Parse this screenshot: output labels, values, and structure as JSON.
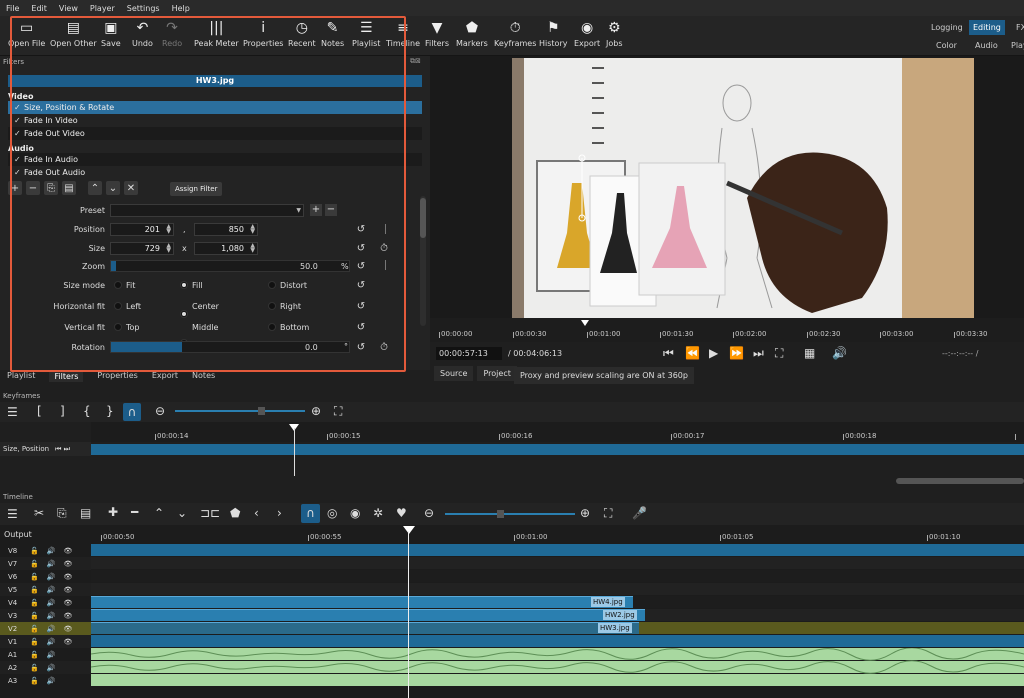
{
  "menu": [
    "File",
    "Edit",
    "View",
    "Player",
    "Settings",
    "Help"
  ],
  "toolbar": [
    {
      "label": "Open File",
      "icon": "open-file-icon"
    },
    {
      "label": "Open Other",
      "icon": "open-other-icon"
    },
    {
      "label": "Save",
      "icon": "save-icon"
    },
    {
      "label": "Undo",
      "icon": "undo-icon"
    },
    {
      "label": "Redo",
      "icon": "redo-icon"
    },
    {
      "label": "Peak Meter",
      "icon": "peak-meter-icon"
    },
    {
      "label": "Properties",
      "icon": "info-icon"
    },
    {
      "label": "Recent",
      "icon": "clock-icon"
    },
    {
      "label": "Notes",
      "icon": "notes-icon"
    },
    {
      "label": "Playlist",
      "icon": "list-icon"
    },
    {
      "label": "Timeline",
      "icon": "timeline-icon"
    },
    {
      "label": "Filters",
      "icon": "funnel-icon"
    },
    {
      "label": "Markers",
      "icon": "marker-icon"
    },
    {
      "label": "Keyframes",
      "icon": "stopwatch-icon"
    },
    {
      "label": "History",
      "icon": "history-icon"
    },
    {
      "label": "Export",
      "icon": "export-icon"
    },
    {
      "label": "Jobs",
      "icon": "gear-icon"
    }
  ],
  "workspaces": {
    "logging": "Logging",
    "editing": "Editing",
    "fx": "FX",
    "color": "Color",
    "audio": "Audio",
    "player": "Play"
  },
  "filters": {
    "title": "Filters",
    "file": "HW3.jpg",
    "video_cat": "Video",
    "audio_cat": "Audio",
    "video_items": [
      "Size, Position & Rotate",
      "Fade In Video",
      "Fade Out Video"
    ],
    "audio_items": [
      "Fade In Audio",
      "Fade Out Audio"
    ],
    "assign": "Assign Filter",
    "preset_label": "Preset",
    "preset_value": "",
    "position_label": "Position",
    "position_x": "201",
    "position_y": "850",
    "position_sep": ",",
    "size_label": "Size",
    "size_w": "729",
    "size_h": "1,080",
    "size_sep": "x",
    "zoom_label": "Zoom",
    "zoom_value": "50.0",
    "zoom_unit": "%",
    "zoom_fraction": 0.02,
    "sizemode_label": "Size mode",
    "sizemode_options": [
      "Fit",
      "Fill",
      "Distort"
    ],
    "hfit_label": "Horizontal fit",
    "hfit_options": [
      "Left",
      "Center",
      "Right"
    ],
    "vfit_label": "Vertical fit",
    "vfit_options": [
      "Top",
      "Middle",
      "Bottom"
    ],
    "rotation_label": "Rotation",
    "rotation_value": "0.0",
    "rotation_unit": "°",
    "rotation_fraction": 0.3
  },
  "bottom_tabs": [
    "Playlist",
    "Filters",
    "Properties",
    "Export",
    "Notes"
  ],
  "player": {
    "ruler": [
      "00:00:00",
      "00:00:30",
      "00:01:00",
      "00:01:30",
      "00:02:00",
      "00:02:30",
      "00:03:00",
      "00:03:30"
    ],
    "current": "00:00:57:13",
    "total": "/ 00:04:06:13",
    "in_out": "--:--:--:-- /",
    "source_tab": "Source",
    "project_tab": "Project",
    "proxy_msg": "Proxy and preview scaling are ON at 360p"
  },
  "keyframes": {
    "title": "Keyframes",
    "ruler": [
      "00:00:14",
      "00:00:15",
      "00:00:16",
      "00:00:17",
      "00:00:18"
    ],
    "track": "Size, Position"
  },
  "timeline": {
    "title": "Timeline",
    "output": "Output",
    "ruler": [
      "00:00:50",
      "00:00:55",
      "00:01:00",
      "00:01:05",
      "00:01:10"
    ],
    "tracks": [
      "V8",
      "V7",
      "V6",
      "V5",
      "V4",
      "V3",
      "V2",
      "V1",
      "A1",
      "A2",
      "A3"
    ],
    "clips": {
      "v4": "HW4.jpg",
      "v3": "HW2.jpg",
      "v2": "HW3.jpg"
    }
  },
  "colors": {
    "accent": "#1c5d8a",
    "highlight_box": "#e35a3b",
    "audio_clip": "#a8d8a0",
    "v2_track": "#5a5a1e"
  }
}
